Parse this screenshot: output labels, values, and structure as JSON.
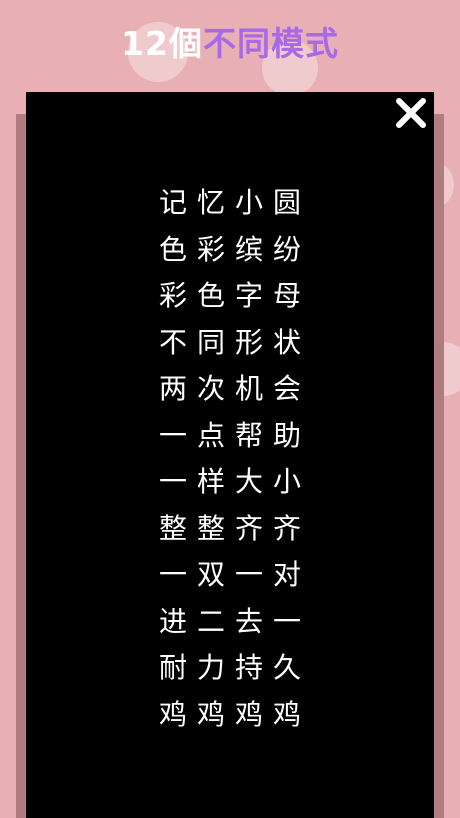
{
  "header": {
    "count": "12個",
    "label": "不同模式"
  },
  "close_icon": "close-icon",
  "modes": [
    "记忆小圆",
    "色彩缤纷",
    "彩色字母",
    "不同形状",
    "两次机会",
    "一点帮助",
    "一样大小",
    "整整齐齐",
    "一双一对",
    "进二去一",
    "耐力持久",
    "鸡鸡鸡鸡"
  ],
  "colors": {
    "background": "#e8b0b4",
    "panel": "#000000",
    "accent": "#a868e8"
  }
}
